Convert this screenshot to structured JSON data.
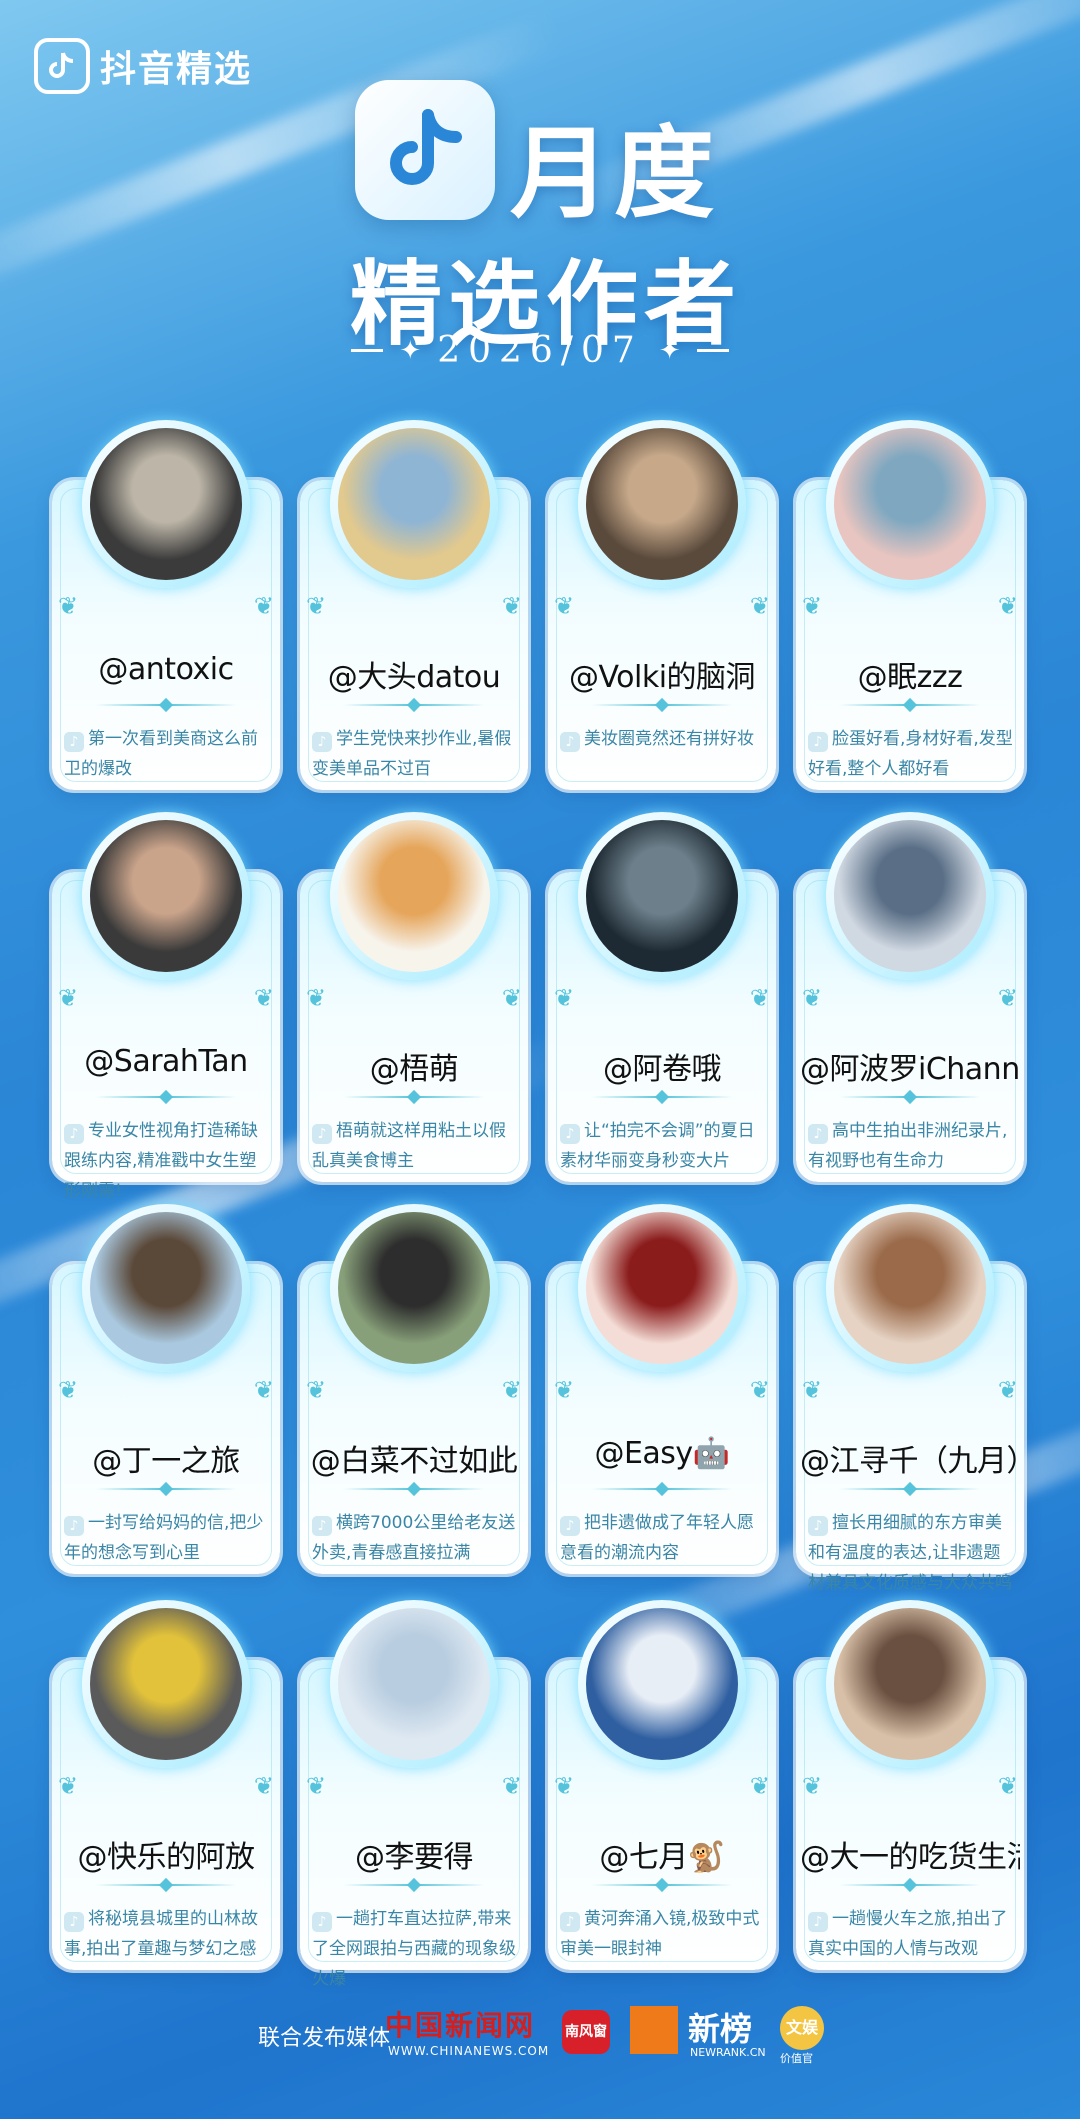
{
  "brand": {
    "name": "抖音精选",
    "icon": "douyin-note-icon"
  },
  "hero": {
    "line1": "月度",
    "line2": "精选作者",
    "date": "2026/07"
  },
  "colors": {
    "accent": "#54c3db",
    "desc": "#3a86a6",
    "bg": "#2a86d6"
  },
  "creators": [
    {
      "name": "@antoxic",
      "desc": "第一次看到美商这么前卫的爆改"
    },
    {
      "name": "@大头datou",
      "desc": "学生党快来抄作业,暑假变美单品不过百"
    },
    {
      "name": "@Volki的脑洞",
      "desc": "美妆圈竟然还有拼好妆"
    },
    {
      "name": "@眠zzz",
      "desc": "脸蛋好看,身材好看,发型好看,整个人都好看"
    },
    {
      "name": "@SarahTan",
      "desc": "专业女性视角打造稀缺跟练内容,精准戳中女生塑形刚需!"
    },
    {
      "name": "@梧萌",
      "desc": "梧萌就这样用粘土以假乱真美食博主"
    },
    {
      "name": "@阿卷哦",
      "desc": "让“拍完不会调”的夏日素材华丽变身秒变大片"
    },
    {
      "name": "@阿波罗iChannel",
      "desc": "高中生拍出非洲纪录片,有视野也有生命力"
    },
    {
      "name": "@丁一之旅",
      "desc": "一封写给妈妈的信,把少年的想念写到心里"
    },
    {
      "name": "@白菜不过如此",
      "desc": "横跨7000公里给老友送外卖,青春感直接拉满"
    },
    {
      "name": "@Easy🤖",
      "desc": "把非遗做成了年轻人愿意看的潮流内容"
    },
    {
      "name": "@江寻千（九月）",
      "desc": "擅长用细腻的东方审美和有温度的表达,让非遗题材兼具文化质感与大众共鸣"
    },
    {
      "name": "@快乐的阿放",
      "desc": "将秘境县城里的山林故事,拍出了童趣与梦幻之感"
    },
    {
      "name": "@李要得",
      "desc": "一趟打车直达拉萨,带来了全网跟拍与西藏的现象级火爆"
    },
    {
      "name": "@七月🐒",
      "desc": "黄河奔涌入镜,极致中式审美一眼封神"
    },
    {
      "name": "@大一的吃货生活",
      "desc": "一趟慢火车之旅,拍出了真实中国的人情与改观"
    }
  ],
  "footer": {
    "label": "联合发布媒体",
    "chinanews": "中国新闻网",
    "chinanews_url": "WWW.CHINANEWS.COM",
    "southnews": "南风窗",
    "newrank": "新榜",
    "newrank_url": "NEWRANK.CN",
    "wenyu": "文娱",
    "wenyu_sub": "价值官"
  }
}
